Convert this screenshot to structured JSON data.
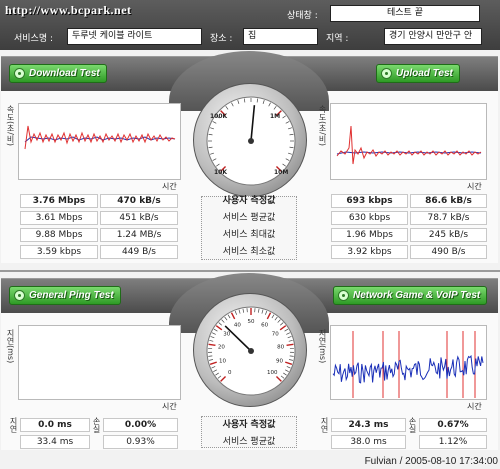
{
  "header": {
    "site_url": "http://www.bcpark.net",
    "status_label": "상태창 :",
    "status_value": "테스트 끝",
    "service_label": "서비스명 :",
    "service_value": "두루넷 케이블 라이트",
    "place_label": "장소 :",
    "place_value": "집",
    "region_label": "지역 :",
    "region_value": "경기 안양시 만안구 안"
  },
  "download": {
    "button": "Download Test",
    "y_axis": "속도(초/비)",
    "x_axis": "시간",
    "gauge": {
      "labels": [
        "10K",
        "100K",
        "1M",
        "10M"
      ],
      "needle_fraction": 0.52
    }
  },
  "upload": {
    "button": "Upload Test",
    "y_axis": "속도(초/비)",
    "x_axis": "시간"
  },
  "speed_stats": {
    "row_labels": [
      "사용자 측정값",
      "서비스 평균값",
      "서비스 최대값",
      "서비스 최소값"
    ],
    "download_bits": [
      "3.76 Mbps",
      "3.61 Mbps",
      "9.88 Mbps",
      "3.59 kbps"
    ],
    "download_bytes": [
      "470 kB/s",
      "451 kB/s",
      "1.24 MB/s",
      "449 B/s"
    ],
    "upload_bits": [
      "693 kbps",
      "630 kbps",
      "1.96 Mbps",
      "3.92 kbps"
    ],
    "upload_bytes": [
      "86.6 kB/s",
      "78.7 kB/s",
      "245 kB/s",
      "490 B/s"
    ]
  },
  "ping": {
    "button": "General Ping Test",
    "y_axis": "지연(ms)",
    "x_axis": "시간",
    "gauge": {
      "labels": [
        "0",
        "10",
        "20",
        "30",
        "40",
        "50",
        "60",
        "70",
        "80",
        "90",
        "100"
      ],
      "needle_fraction": 0.33
    }
  },
  "game": {
    "button": "Network Game & VoIP Test",
    "y_axis": "지연(ms)",
    "x_axis": "시간"
  },
  "ping_stats": {
    "row_labels": [
      "사용자 측정값",
      "서비스 평균값"
    ],
    "ping_side_1": "지연",
    "ping_side_2": "손실",
    "game_side_1": "지연",
    "game_side_2": "손실",
    "ping_latency": [
      "0.0 ms",
      "33.4 ms"
    ],
    "ping_loss": [
      "0.00%",
      "0.93%"
    ],
    "game_latency": [
      "24.3 ms",
      "38.0 ms"
    ],
    "game_loss": [
      "0.67%",
      "1.12%"
    ]
  },
  "footer": "Fulvian / 2005-08-10 17:34:00",
  "colors": {
    "accent_green": "#2e9a25",
    "line_red": "#e03030",
    "line_blue": "#2030b0"
  }
}
